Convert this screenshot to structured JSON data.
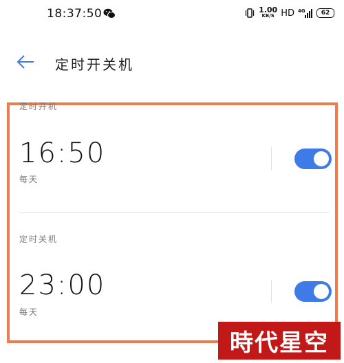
{
  "status_bar": {
    "time": "18:37:50",
    "wechat_icon": "wechat-icon",
    "net_speed_value": "1.00",
    "net_speed_unit": "KB/S",
    "hd_label": "HD",
    "network_type": "4G",
    "battery_level": "62"
  },
  "header": {
    "back_icon": "back-arrow-icon",
    "title": "定时开关机"
  },
  "schedule": {
    "power_on": {
      "label": "定时开机",
      "time": "16:50",
      "repeat": "每天",
      "enabled": true
    },
    "power_off": {
      "label": "定时关机",
      "time": "23:00",
      "repeat": "每天",
      "enabled": true
    }
  },
  "watermark": {
    "text": "時代星空"
  },
  "colors": {
    "accent": "#3f7be6",
    "highlight_border": "#ef7a4e",
    "watermark_bg": "#c21818"
  }
}
